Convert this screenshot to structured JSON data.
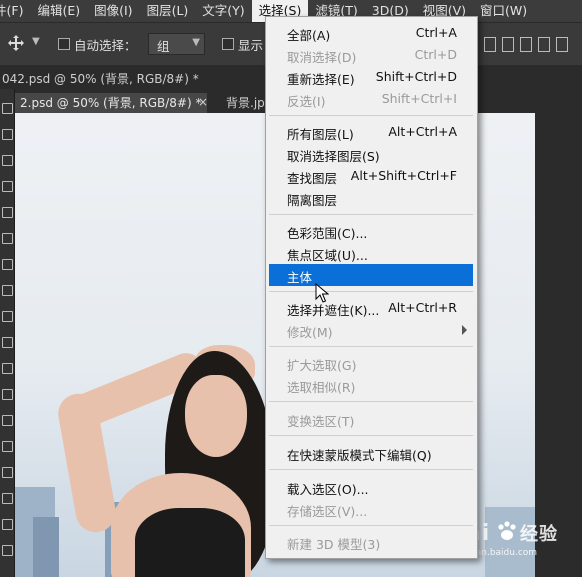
{
  "menubar": {
    "items": [
      "件(F)",
      "编辑(E)",
      "图像(I)",
      "图层(L)",
      "文字(Y)",
      "选择(S)",
      "滤镜(T)",
      "3D(D)",
      "视图(V)",
      "窗口(W)"
    ]
  },
  "optbar": {
    "auto_select_label": "自动选择：",
    "auto_select_value": "组",
    "show_label": "显示"
  },
  "tabs": {
    "row1": "042.psd @ 50% (背景, RGB/8#) *",
    "row2_current": "2.psd @ 50% (背景, RGB/8#) *",
    "row2_close": "×",
    "row2_next": "背景.jp"
  },
  "menu": {
    "items": [
      {
        "label": "全部(A)",
        "shortcut": "Ctrl+A",
        "disabled": false
      },
      {
        "label": "取消选择(D)",
        "shortcut": "Ctrl+D",
        "disabled": true
      },
      {
        "label": "重新选择(E)",
        "shortcut": "Shift+Ctrl+D",
        "disabled": false
      },
      {
        "label": "反选(I)",
        "shortcut": "Shift+Ctrl+I",
        "disabled": true
      },
      {
        "label": "所有图层(L)",
        "shortcut": "Alt+Ctrl+A",
        "disabled": false
      },
      {
        "label": "取消选择图层(S)",
        "shortcut": "",
        "disabled": false
      },
      {
        "label": "查找图层",
        "shortcut": "Alt+Shift+Ctrl+F",
        "disabled": false
      },
      {
        "label": "隔离图层",
        "shortcut": "",
        "disabled": false
      },
      {
        "label": "色彩范围(C)...",
        "shortcut": "",
        "disabled": false
      },
      {
        "label": "焦点区域(U)...",
        "shortcut": "",
        "disabled": false
      },
      {
        "label": "主体",
        "shortcut": "",
        "disabled": false,
        "highlighted": true
      },
      {
        "label": "选择并遮住(K)...",
        "shortcut": "Alt+Ctrl+R",
        "disabled": false
      },
      {
        "label": "修改(M)",
        "shortcut": "",
        "disabled": true,
        "submenu": true
      },
      {
        "label": "扩大选取(G)",
        "shortcut": "",
        "disabled": true
      },
      {
        "label": "选取相似(R)",
        "shortcut": "",
        "disabled": true
      },
      {
        "label": "变换选区(T)",
        "shortcut": "",
        "disabled": true
      },
      {
        "label": "在快速蒙版模式下编辑(Q)",
        "shortcut": "",
        "disabled": false
      },
      {
        "label": "载入选区(O)...",
        "shortcut": "",
        "disabled": false
      },
      {
        "label": "存储选区(V)...",
        "shortcut": "",
        "disabled": true
      },
      {
        "label": "新建 3D 模型(3)",
        "shortcut": "",
        "disabled": true
      }
    ]
  },
  "watermark": {
    "brand": "Bai",
    "brand2": "经验",
    "url": "jingyan.baidu.com"
  },
  "colors": {
    "highlight": "#0a6fd6",
    "menu_bg": "#f0f0f0",
    "app_bg": "#2b2b2b"
  }
}
